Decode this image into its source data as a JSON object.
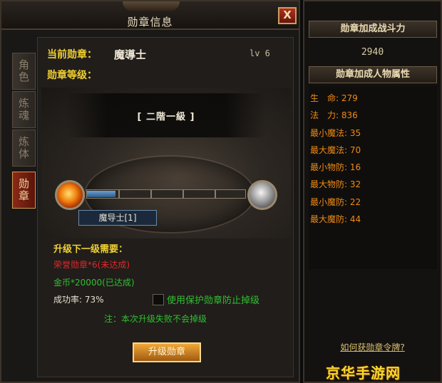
{
  "window": {
    "title": "勋章信息",
    "close_label": "X"
  },
  "tabs": [
    {
      "label": "角色",
      "active": false
    },
    {
      "label": "炼魂",
      "active": false
    },
    {
      "label": "炼体",
      "active": false
    },
    {
      "label": "勋章",
      "active": true
    }
  ],
  "medal": {
    "current_label": "当前勋章：",
    "current_name": "魔導士",
    "level_text": "lv 6",
    "grade_label": "勋章等级：",
    "rank_text": "[ 二階一級 ]",
    "progress_fraction": 0.18,
    "level_tag": "魔导士[1]"
  },
  "requirements": {
    "title": "升级下一级需要：",
    "items": [
      {
        "text": "荣誉勋章*6(未达成)",
        "status_color": "#e02828"
      },
      {
        "text": "金币*20000(已达成)",
        "status_color": "#30c030"
      }
    ],
    "success_rate": "成功率: 73%",
    "protect_label": "使用保护勋章防止掉级",
    "protect_checked": false,
    "note": "注：本次升级失败不会掉级",
    "upgrade_button": "升级勋章"
  },
  "right": {
    "power_header": "勋章加成战斗力",
    "power_value": "2940",
    "attr_header": "勋章加成人物属性",
    "attributes": [
      "生　命: 279",
      "法　力: 836",
      "最小魔法: 35",
      "最大魔法: 70",
      "最小物防: 16",
      "最大物防: 32",
      "最小魔防: 22",
      "最大魔防: 44"
    ],
    "howto_link": "如何获勋章令牌?"
  },
  "watermark": "京华手游网",
  "colors": {
    "accent_gold": "#f0d030",
    "unmet_red": "#e02828",
    "met_green": "#30c030",
    "attribute_orange": "#f08a14"
  }
}
